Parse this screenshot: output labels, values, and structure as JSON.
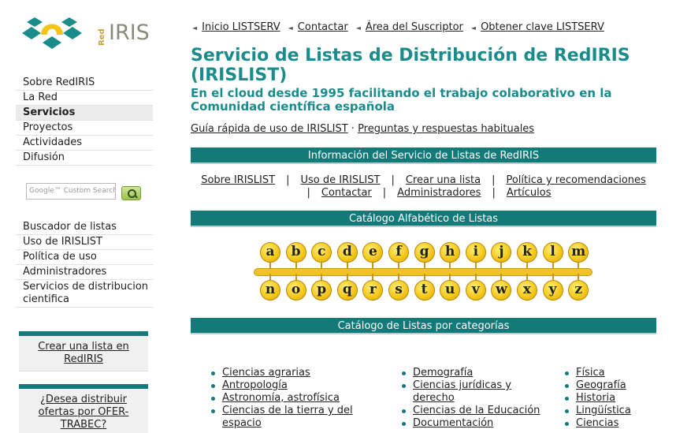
{
  "logo": {
    "red": "Red",
    "iris": "IRIS"
  },
  "side_menu": [
    "Sobre RedIRIS",
    "La Red",
    "Servicios",
    "Proyectos",
    "Actividades",
    "Difusión"
  ],
  "side_menu_active": "Servicios",
  "search": {
    "placeholder": "Google™ Custom Search"
  },
  "side_tools": [
    "Buscador de listas",
    "Uso de IRISLIST",
    "Política de uso",
    "Administradores",
    "Servicios de distribucion cientifica"
  ],
  "box1": "Crear una lista en RedIRIS",
  "box2": "¿Desea distribuir ofertas por OFER-TRABEC?",
  "topnav": [
    "Inicio LISTSERV",
    "Contactar",
    "Área del Suscriptor",
    "Obtener clave LISTSERV"
  ],
  "title": "Servicio de Listas de Distribución de RedIRIS (IRISLIST)",
  "subtitle": "En el cloud desde 1995 facilitando el trabajo colaborativo en la Comunidad científica española",
  "quicklinks": {
    "guide": "Guía rápida de uso de IRISLIST",
    "sep": "·",
    "faq": "Preguntas y respuestas habituales"
  },
  "bars": {
    "info": "Información del Servicio de Listas de RedIRIS",
    "alpha": "Catálogo Alfabético de Listas",
    "categories": "Catálogo de Listas por categorías"
  },
  "infolinks": [
    "Sobre IRISLIST",
    "Uso de IRISLIST",
    "Crear una lista",
    "Política y recomendaciones",
    "Contactar",
    "Administradores",
    "Artículos"
  ],
  "alphabet_top": [
    "a",
    "b",
    "c",
    "d",
    "e",
    "f",
    "g",
    "h",
    "i",
    "j",
    "k",
    "l",
    "m"
  ],
  "alphabet_bottom": [
    "n",
    "o",
    "p",
    "q",
    "r",
    "s",
    "t",
    "u",
    "v",
    "w",
    "x",
    "y",
    "z"
  ],
  "categories": {
    "col1": [
      "Ciencias agrarias",
      "Antropología",
      "Astronomía, astrofísica",
      "Ciencias de la tierra y del espacio"
    ],
    "col2": [
      "Demografía",
      "Ciencias jurídicas y derecho",
      "Ciencias de la Educación",
      "Documentación"
    ],
    "col3": [
      "Física",
      "Geografía",
      "Historia",
      "Lingüística",
      "Ciencias"
    ]
  },
  "colors": {
    "teal": "#137a7a",
    "title_teal": "#1a8c8c",
    "ball_yellow": "#f4c518"
  }
}
